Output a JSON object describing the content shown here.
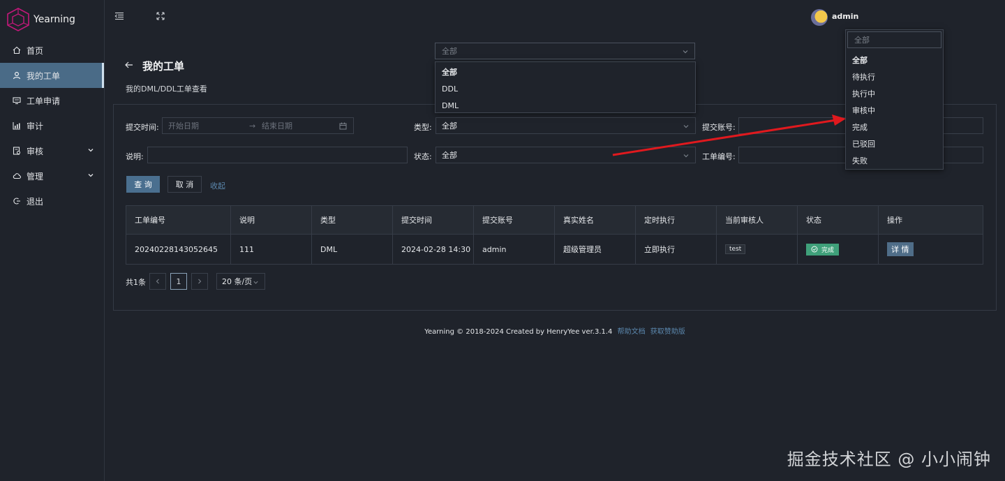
{
  "app": {
    "name": "Yearning"
  },
  "sidebar": {
    "items": [
      {
        "label": "首页",
        "icon": "home-icon"
      },
      {
        "label": "我的工单",
        "icon": "user-icon",
        "active": true
      },
      {
        "label": "工单申请",
        "icon": "monitor-icon"
      },
      {
        "label": "审计",
        "icon": "chart-icon"
      },
      {
        "label": "审核",
        "icon": "audit-icon",
        "expandable": true
      },
      {
        "label": "管理",
        "icon": "cloud-icon",
        "expandable": true
      },
      {
        "label": "退出",
        "icon": "logout-icon"
      }
    ]
  },
  "header": {
    "user": "admin"
  },
  "page": {
    "title": "我的工单",
    "subtitle": "我的DML/DDL工单查看"
  },
  "filters": {
    "submit_time_label": "提交时间:",
    "start_placeholder": "开始日期",
    "end_placeholder": "结束日期",
    "type_label": "类型:",
    "type_value": "全部",
    "account_label": "提交账号:",
    "desc_label": "说明:",
    "status_label": "状态:",
    "status_value": "全部",
    "order_label": "工单编号:",
    "query_button": "查 询",
    "cancel_button": "取 消",
    "collapse_link": "收起"
  },
  "table": {
    "columns": [
      "工单编号",
      "说明",
      "类型",
      "提交时间",
      "提交账号",
      "真实姓名",
      "定时执行",
      "当前审核人",
      "状态",
      "操作"
    ],
    "rows": [
      {
        "order_id": "20240228143052645",
        "desc": "111",
        "type": "DML",
        "time": "2024-02-28 14:30",
        "account": "admin",
        "real_name": "超级管理员",
        "schedule": "立即执行",
        "reviewer": "test",
        "status": "完成",
        "action": "详 情"
      }
    ]
  },
  "pagination": {
    "total": "共1条",
    "current_page": "1",
    "page_size": "20 条/页"
  },
  "footer": {
    "text": "Yearning © 2018-2024 Created by HenryYee ver.3.1.4",
    "help_link": "帮助文档",
    "sponsor_link": "获取赞助版"
  },
  "type_dropdown": {
    "placeholder": "全部",
    "options": [
      "全部",
      "DDL",
      "DML"
    ]
  },
  "status_dropdown": {
    "placeholder": "全部",
    "options": [
      "全部",
      "待执行",
      "执行中",
      "审核中",
      "完成",
      "已驳回",
      "失败"
    ]
  },
  "watermark": "掘金技术社区 @ 小小闹钟",
  "colors": {
    "background": "#1f232b",
    "accent": "#4a6b87",
    "link": "#5b87ad",
    "success": "#3fa07a",
    "arrow": "#e0191e"
  }
}
